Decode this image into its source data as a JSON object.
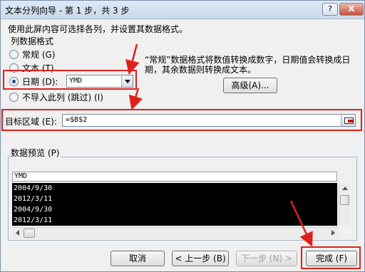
{
  "window": {
    "title": "文本分列向导 - 第 1 步，共 3 步",
    "help_btn": "?",
    "close_btn": "X"
  },
  "instruction": "使用此屏内容可选择各列，并设置其数据格式。",
  "column_format": {
    "group_title": "列数据格式",
    "options": [
      {
        "label": "常规 (G)",
        "selected": false
      },
      {
        "label": "文本 (T)",
        "selected": false
      },
      {
        "label": "日期 (D):",
        "selected": true
      },
      {
        "label": "不导入此列 (跳过) (I)",
        "selected": false
      }
    ],
    "date_format_value": "YMD",
    "description": "“常规”数据格式将数值转换成数字，日期值会转换成日期，其余数据则转换成文本。",
    "advanced_btn": "高级(A)..."
  },
  "destination": {
    "label": "目标区域 (E):",
    "value": "=$B$2"
  },
  "preview": {
    "title": "数据预览 (P)",
    "column_header": "YMD",
    "rows": [
      "2004/9/30",
      "2012/3/11",
      "2004/9/30",
      "2012/3/11"
    ]
  },
  "buttons": {
    "cancel": "取消",
    "back": "< 上一步 (B)",
    "next": "下一步 (N) >",
    "finish": "完成 (F)"
  },
  "colors": {
    "highlight": "#e0201b",
    "accent": "#1f4f95"
  }
}
